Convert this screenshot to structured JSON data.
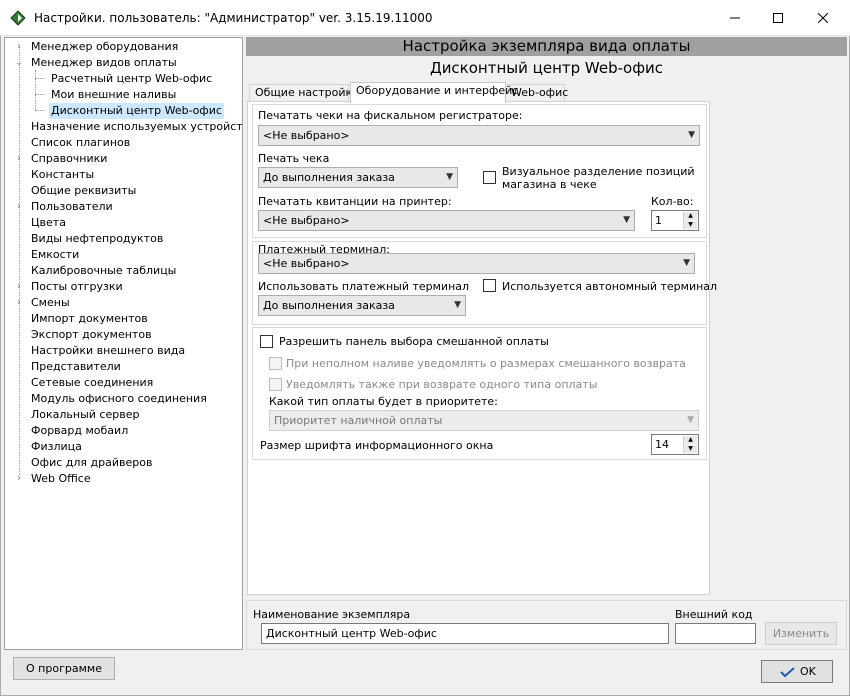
{
  "window": {
    "title": "Настройки. пользователь: \"Администратор\" ver. 3.15.19.11000",
    "minimize_glyph": "—",
    "maximize_glyph": "☐",
    "close_glyph": "✕"
  },
  "tree": {
    "items": [
      {
        "label": "Менеджер оборудования",
        "expander": "›"
      },
      {
        "label": "Менеджер видов оплаты",
        "expander": "⌄"
      },
      {
        "label": "Расчетный центр Web-офис",
        "expander": ""
      },
      {
        "label": "Мои внешние наливы",
        "expander": ""
      },
      {
        "label": "Дисконтный центр Web-офис",
        "expander": "",
        "selected": true
      },
      {
        "label": "Назначение используемых устройств",
        "expander": ""
      },
      {
        "label": "Список плагинов",
        "expander": ""
      },
      {
        "label": "Справочники",
        "expander": "›"
      },
      {
        "label": "Константы",
        "expander": ""
      },
      {
        "label": "Общие реквизиты",
        "expander": ""
      },
      {
        "label": "Пользователи",
        "expander": "›"
      },
      {
        "label": "Цвета",
        "expander": ""
      },
      {
        "label": "Виды нефтепродуктов",
        "expander": ""
      },
      {
        "label": "Емкости",
        "expander": ""
      },
      {
        "label": "Калибровочные таблицы",
        "expander": ""
      },
      {
        "label": "Посты отгрузки",
        "expander": "›"
      },
      {
        "label": "Смены",
        "expander": "›"
      },
      {
        "label": "Импорт документов",
        "expander": ""
      },
      {
        "label": "Экспорт документов",
        "expander": ""
      },
      {
        "label": "Настройки внешнего вида",
        "expander": ""
      },
      {
        "label": "Представители",
        "expander": ""
      },
      {
        "label": "Сетевые соединения",
        "expander": ""
      },
      {
        "label": "Модуль офисного соединения",
        "expander": ""
      },
      {
        "label": "Локальный сервер",
        "expander": ""
      },
      {
        "label": "Форвард мобаил",
        "expander": ""
      },
      {
        "label": "Физлица",
        "expander": ""
      },
      {
        "label": "Офис для драйверов",
        "expander": ""
      },
      {
        "label": "Web Office",
        "expander": "›"
      }
    ]
  },
  "header": {
    "title": "Настройка экземпляра вида оплаты",
    "subtitle": "Дисконтный центр Web-офис"
  },
  "tabs": [
    {
      "label": "Общие настройки"
    },
    {
      "label": "Оборудование и интерфейс",
      "active": true
    },
    {
      "label": "Web-офис"
    }
  ],
  "hardware": {
    "fiscal_label": "Печатать чеки на фискальном регистраторе:",
    "fiscal_value": "<Не выбрано>",
    "receipt_print_label": "Печать чека",
    "receipt_print_value": "До выполнения заказа",
    "visual_split_label_line1": "Визуальное разделение позиций",
    "visual_split_label_line2": "магазина в чеке",
    "visual_split_checked": false,
    "printer_label": "Печатать квитанции на принтер:",
    "printer_value": "<Не выбрано>",
    "count_label": "Кол-во:",
    "count_value": "1"
  },
  "terminal": {
    "label": "Платежный терминал:",
    "value": "<Не выбрано>",
    "use_label": "Использовать платежный терминал",
    "use_value": "До выполнения заказа",
    "autonomous_label": "Используется автономный терминал",
    "autonomous_checked": false
  },
  "mixed": {
    "allow_label": "Разрешить панель выбора смешанной оплаты",
    "allow_checked": false,
    "notify_partial_label": "При неполном наливе уведомлять о размерах смешанного возврата",
    "notify_single_label": "Уведомлять также при возврате одного типа оплаты",
    "priority_label": "Какой тип оплаты будет в приоритете:",
    "priority_value": "Приоритет наличной оплаты",
    "font_size_label": "Размер шрифта информационного окна",
    "font_size_value": "14"
  },
  "instance": {
    "name_label": "Наименование экземпляра",
    "name_value": "Дисконтный центр Web-офис",
    "ext_code_label": "Внешний код",
    "ext_code_value": "",
    "change_button": "Изменить"
  },
  "footer": {
    "about_button": "О программе",
    "ok_button": "OK"
  }
}
